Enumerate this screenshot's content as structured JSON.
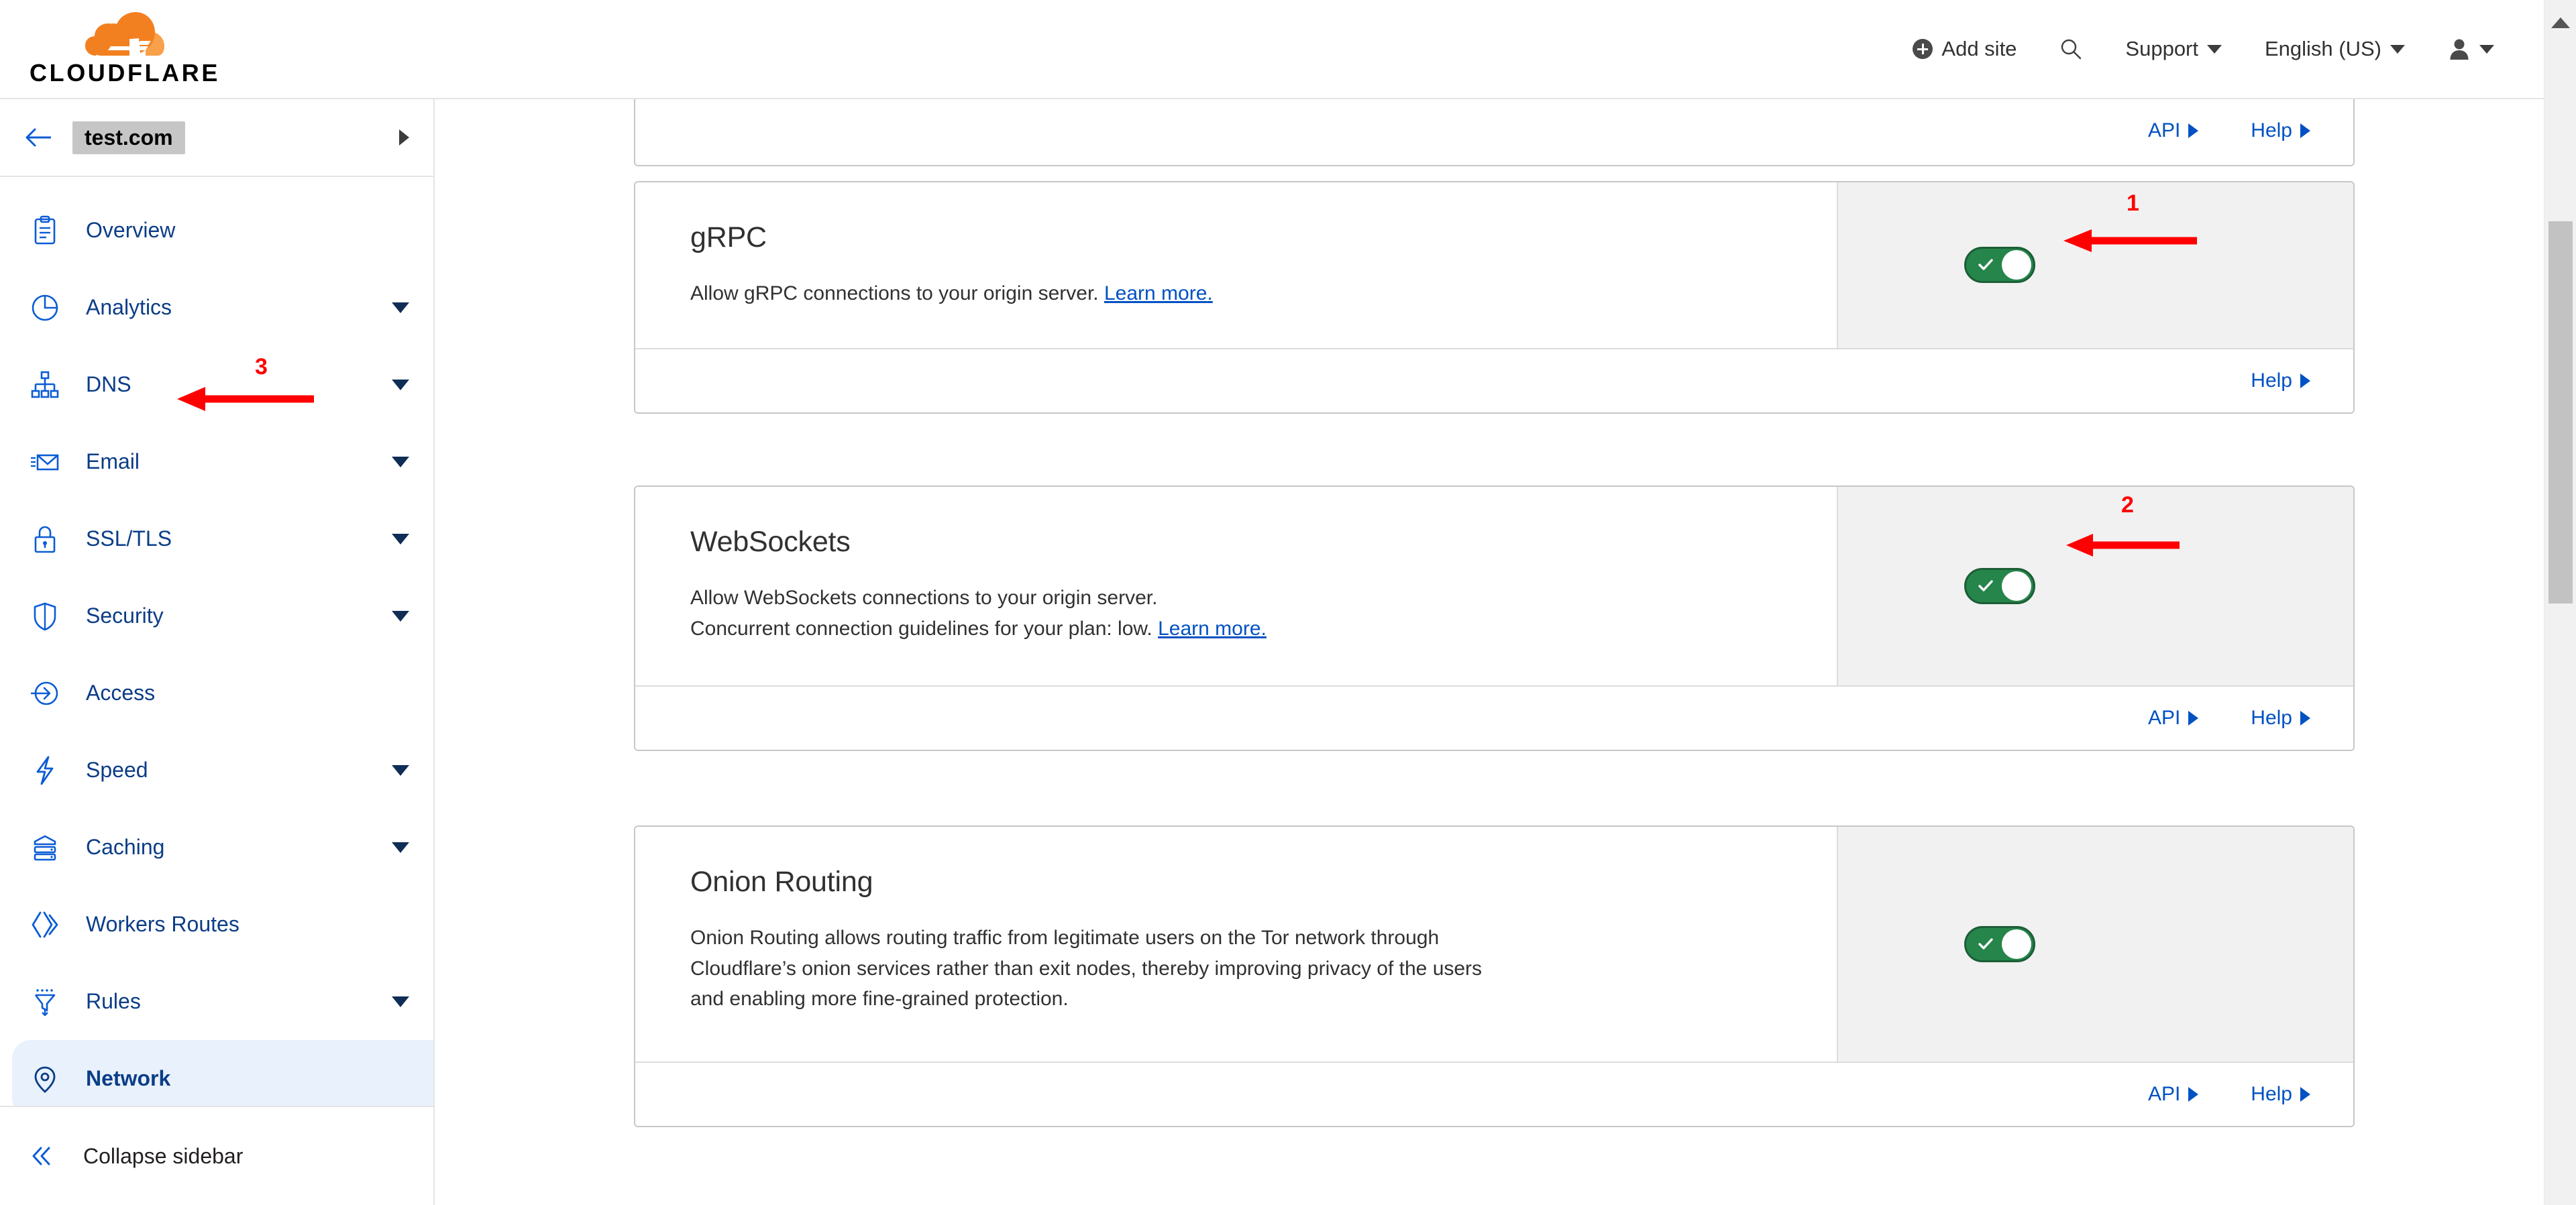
{
  "header": {
    "logo_word": "CLOUDFLARE",
    "logo_icon": "cloudflare-cloud-icon",
    "add_site": "Add site",
    "search_icon": "search-icon",
    "support": "Support",
    "language": "English (US)",
    "account_icon": "user-avatar-icon"
  },
  "sidebar": {
    "back_icon": "back-arrow-icon",
    "site_name": "test.com",
    "collapse_label": "Collapse sidebar",
    "collapse_icon": "double-chevron-left-icon",
    "items": [
      {
        "label": "Overview",
        "icon": "clipboard-icon",
        "expandable": false,
        "active": false
      },
      {
        "label": "Analytics",
        "icon": "pie-chart-icon",
        "expandable": true,
        "active": false
      },
      {
        "label": "DNS",
        "icon": "sitemap-icon",
        "expandable": true,
        "active": false
      },
      {
        "label": "Email",
        "icon": "envelope-icon",
        "expandable": true,
        "active": false
      },
      {
        "label": "SSL/TLS",
        "icon": "lock-icon",
        "expandable": true,
        "active": false
      },
      {
        "label": "Security",
        "icon": "shield-icon",
        "expandable": true,
        "active": false
      },
      {
        "label": "Access",
        "icon": "login-arrow-icon",
        "expandable": false,
        "active": false
      },
      {
        "label": "Speed",
        "icon": "lightning-bolt-icon",
        "expandable": true,
        "active": false
      },
      {
        "label": "Caching",
        "icon": "server-stack-icon",
        "expandable": true,
        "active": false
      },
      {
        "label": "Workers Routes",
        "icon": "workers-icon",
        "expandable": false,
        "active": false
      },
      {
        "label": "Rules",
        "icon": "funnel-icon",
        "expandable": true,
        "active": false
      },
      {
        "label": "Network",
        "icon": "location-pin-icon",
        "expandable": false,
        "active": true
      }
    ]
  },
  "main": {
    "partial_card_top": {
      "api_label": "API",
      "help_label": "Help"
    },
    "cards": [
      {
        "title": "gRPC",
        "desc_lines": [
          "Allow gRPC connections to your origin server."
        ],
        "learn_more": "Learn more",
        "learn_more_suffix": ".",
        "toggle_state": "on",
        "footer_links": [
          "Help"
        ]
      },
      {
        "title": "WebSockets",
        "desc_lines": [
          "Allow WebSockets connections to your origin server.",
          "Concurrent connection guidelines for your plan: low."
        ],
        "learn_more": "Learn more",
        "learn_more_suffix": ".",
        "toggle_state": "on",
        "footer_links": [
          "API",
          "Help"
        ]
      },
      {
        "title": "Onion Routing",
        "desc_lines": [
          "Onion Routing allows routing traffic from legitimate users on the Tor network through",
          "Cloudflare’s onion services rather than exit nodes, thereby improving privacy of the users",
          "and enabling more fine-grained protection."
        ],
        "learn_more": "",
        "learn_more_suffix": "",
        "toggle_state": "on",
        "footer_links": [
          "API",
          "Help"
        ]
      }
    ]
  },
  "annotations": [
    {
      "number": "1",
      "target": "grpc-toggle"
    },
    {
      "number": "2",
      "target": "websockets-toggle"
    },
    {
      "number": "3",
      "target": "sidebar-item-dns"
    }
  ],
  "colors": {
    "brand_orange": "#f38020",
    "link_blue": "#0051c3",
    "nav_blue": "#0b3d87",
    "toggle_green": "#26854a",
    "annotation_red": "#ff0000",
    "panel_gray": "#f1f1f1"
  },
  "scrollbar": {
    "up_arrow_icon": "scroll-up-arrow-icon"
  }
}
